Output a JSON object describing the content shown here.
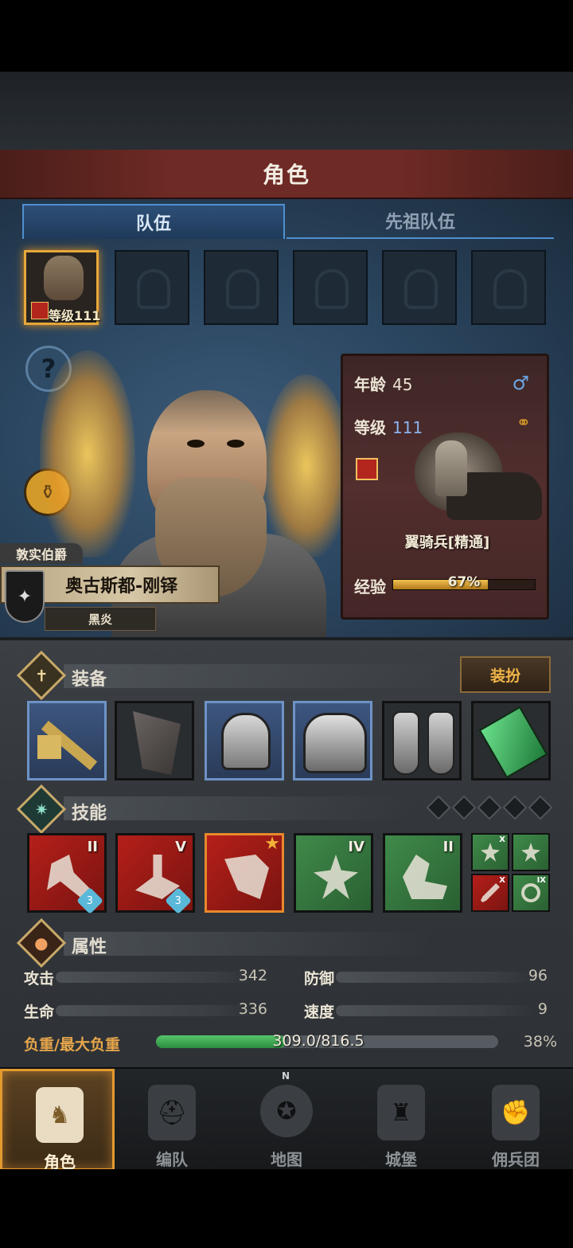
{
  "header": {
    "title": "角色"
  },
  "tabs": [
    {
      "label": "队伍",
      "active": true
    },
    {
      "label": "先祖队伍",
      "active": false
    }
  ],
  "party": {
    "active_member_level": "等级111",
    "empty_slots": 5
  },
  "hero": {
    "noble_title": "敦实伯爵",
    "name": "奥古斯都-刚铎",
    "trait": "黑炎",
    "age_label": "年龄",
    "age": "45",
    "level_label": "等级",
    "level": "111",
    "unit_class": "翼骑兵[精通]",
    "exp_label": "经验",
    "exp_text": "67%",
    "exp_percent": 67,
    "gender_icon": "male-icon",
    "marriage_icon": "rings-icon"
  },
  "equipment": {
    "title": "装备",
    "dress_button": "装扮",
    "items": [
      {
        "name": "war-hammer-icon",
        "highlight": true
      },
      {
        "name": "banner-icon",
        "highlight": false
      },
      {
        "name": "great-helm-icon",
        "highlight": true
      },
      {
        "name": "plate-armor-icon",
        "highlight": true
      },
      {
        "name": "greaves-icon",
        "highlight": false
      },
      {
        "name": "emerald-relic-icon",
        "highlight": false
      }
    ]
  },
  "skills": {
    "title": "技能",
    "slots_indicator": 5,
    "items": [
      {
        "roman": "II",
        "color": "red",
        "gem": "3"
      },
      {
        "roman": "V",
        "color": "red",
        "gem": "3"
      },
      {
        "roman": "",
        "color": "red",
        "star": true
      },
      {
        "roman": "IV",
        "color": "green"
      },
      {
        "roman": "II",
        "color": "green"
      }
    ],
    "mini": [
      {
        "roman": "X",
        "color": "green"
      },
      {
        "roman": "",
        "color": "green"
      },
      {
        "roman": "X",
        "color": "red"
      },
      {
        "roman": "IX",
        "color": "green"
      }
    ]
  },
  "attributes": {
    "title": "属性",
    "attack_label": "攻击",
    "attack": "342",
    "defense_label": "防御",
    "defense": "96",
    "hp_label": "生命",
    "hp": "336",
    "speed_label": "速度",
    "speed": "9",
    "load_label": "负重/最大负重",
    "load_text": "309.0/816.5",
    "load_percent_text": "38%",
    "load_percent": 38
  },
  "bottom_nav": [
    {
      "label": "角色",
      "active": true
    },
    {
      "label": "编队",
      "active": false
    },
    {
      "label": "地图",
      "active": false
    },
    {
      "label": "城堡",
      "active": false
    },
    {
      "label": "佣兵团",
      "active": false
    }
  ],
  "compass_mark": "N",
  "colors": {
    "accent_orange": "#e39a2e",
    "tab_blue": "#4f8fd0",
    "title_red": "#6e2a24",
    "load_green": "#3ea852"
  }
}
